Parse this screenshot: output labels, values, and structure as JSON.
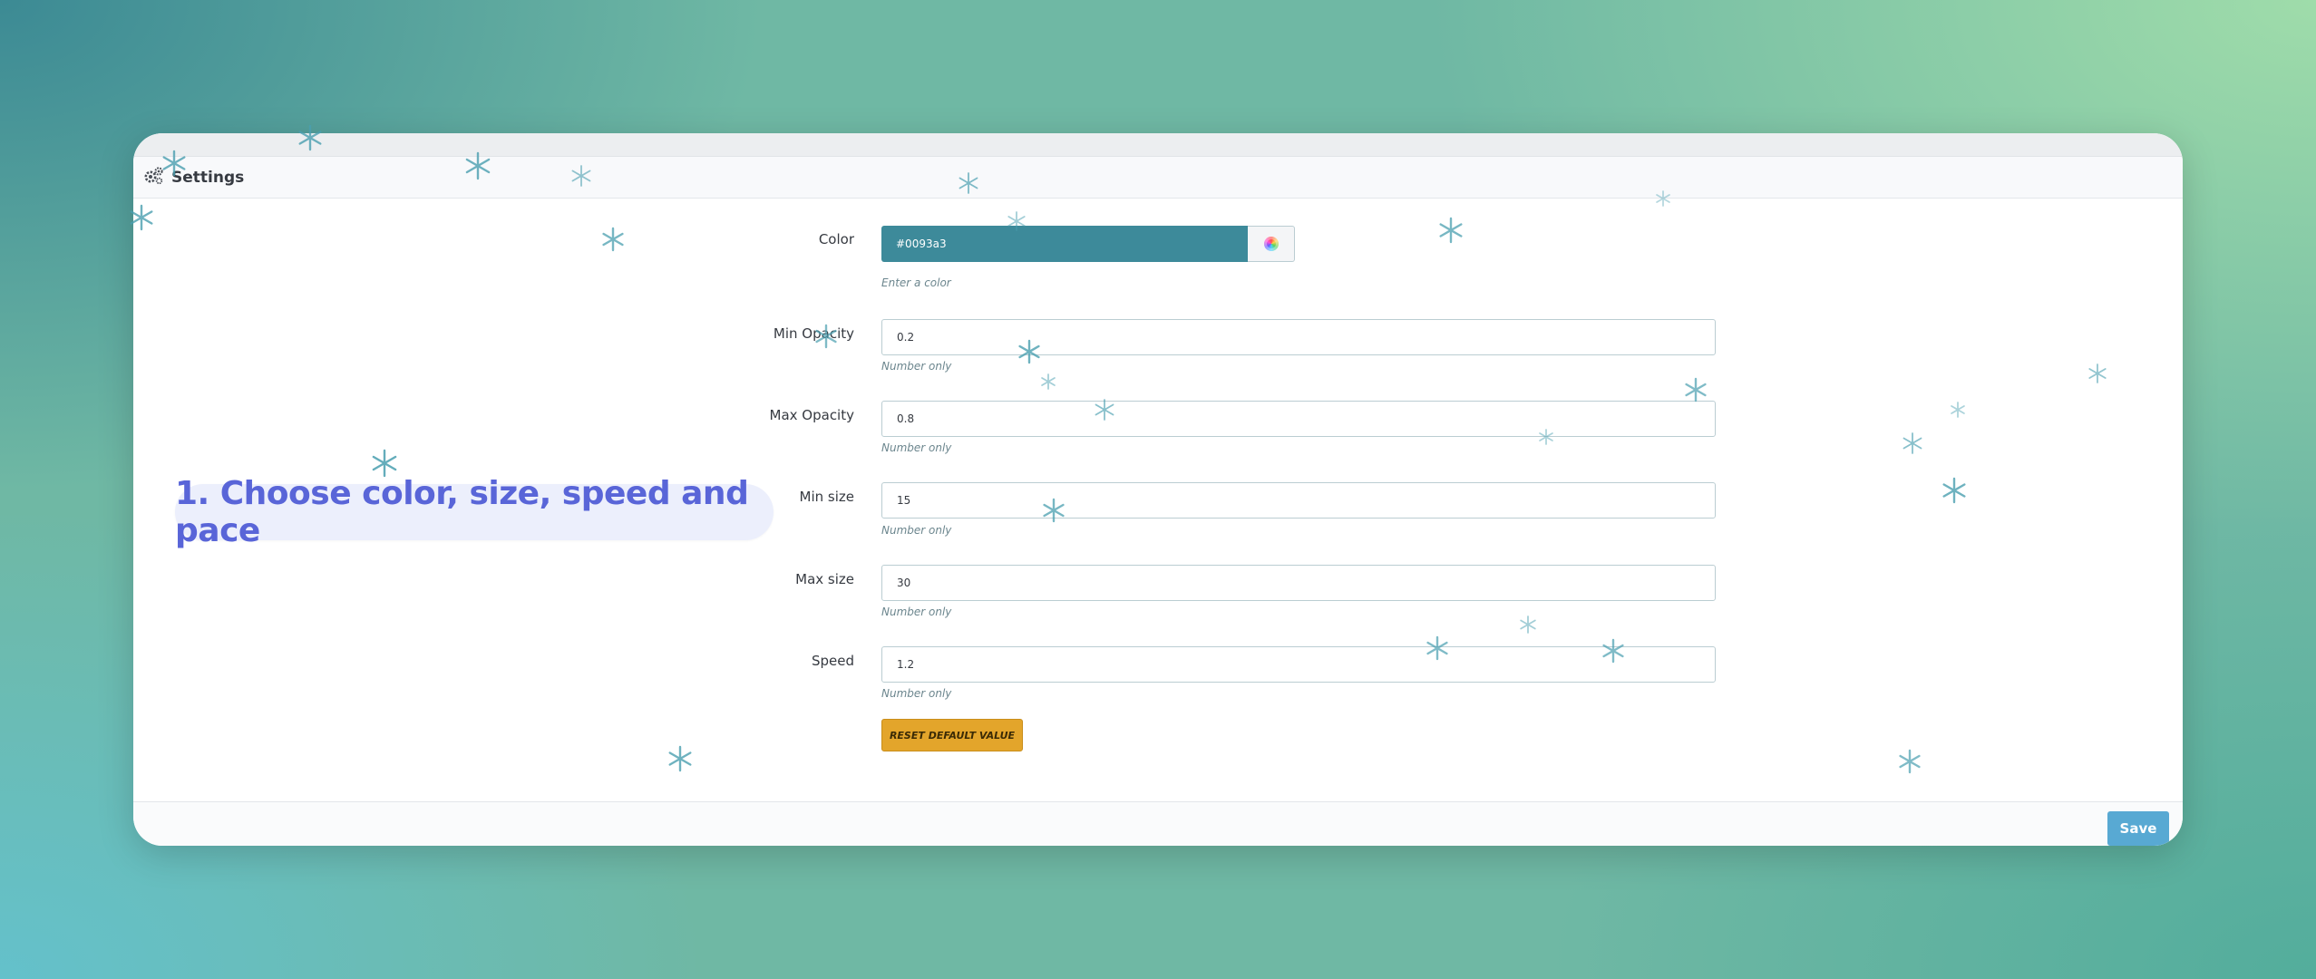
{
  "panel": {
    "title": "Settings",
    "icon": "gears-icon"
  },
  "fields": {
    "color": {
      "label": "Color",
      "value": "#0093a3",
      "help": "Enter a color"
    },
    "min_opacity": {
      "label": "Min Opacity",
      "value": "0.2",
      "help": "Number only"
    },
    "max_opacity": {
      "label": "Max Opacity",
      "value": "0.8",
      "help": "Number only"
    },
    "min_size": {
      "label": "Min size",
      "value": "15",
      "help": "Number only"
    },
    "max_size": {
      "label": "Max size",
      "value": "30",
      "help": "Number only"
    },
    "speed": {
      "label": "Speed",
      "value": "1.2",
      "help": "Number only"
    }
  },
  "buttons": {
    "reset": "RESET DEFAULT VALUE",
    "save": "Save"
  },
  "callout": {
    "text": "1. Choose color, size, speed and pace"
  },
  "colors": {
    "color_swatch": "#3d8a9a",
    "reset_button": "#e3a52b",
    "save_button": "#58a9d3",
    "callout_text": "#5965d8",
    "snowflake": "#4a9fb0"
  }
}
